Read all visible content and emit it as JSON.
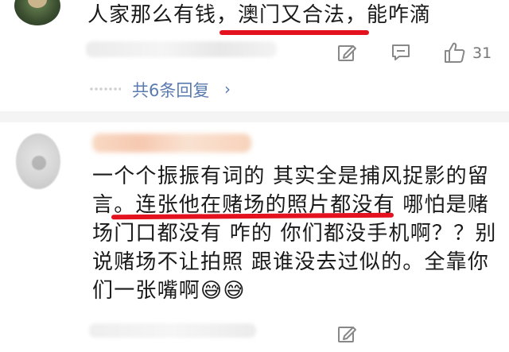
{
  "comments": [
    {
      "text": "人家那么有钱，澳门又合法，能咋滴",
      "like_count": "31",
      "reply_link": "共6条回复",
      "reply_chevron": "›"
    },
    {
      "lines": [
        "一个个振振有词的 其实全是捕风捉影的留",
        "言。连张他在赌场的照片都没有 哪怕是赌",
        "场门口都没有 咋的 你们都没手机啊？？别",
        "说赌场不让拍照 跟谁没去过似的。全靠你",
        "们一张嘴啊"
      ],
      "emoji": [
        "😅",
        "😅"
      ]
    }
  ],
  "colors": {
    "underline": "#e3121e",
    "link": "#5a7bb0",
    "meta": "#777777"
  },
  "icons": [
    "edit-icon",
    "message-icon",
    "thumbs-up-icon"
  ]
}
